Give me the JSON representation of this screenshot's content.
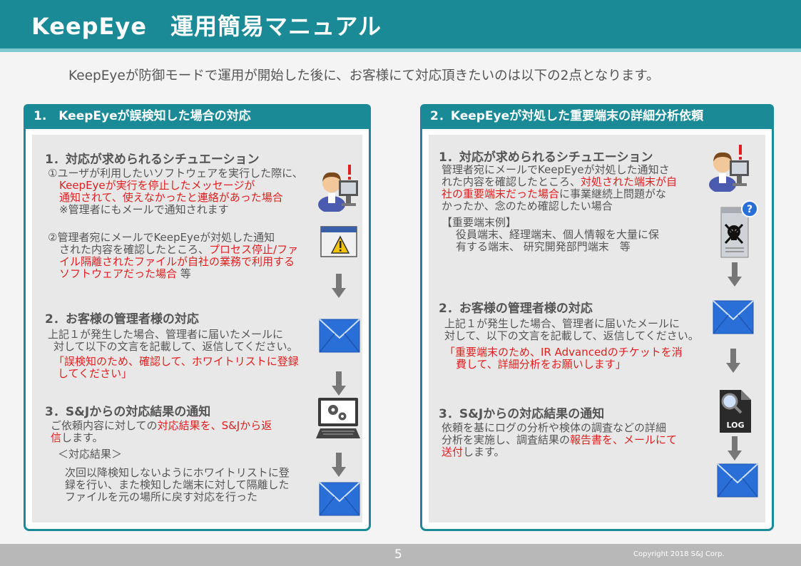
{
  "header": {
    "title": "KeepEye　運用簡易マニュアル"
  },
  "intro": "KeepEyeが防御モードで運用が開始した後に、お客様にて対応頂きたいのは以下の2点となります。",
  "left": {
    "heading": "1.　KeepEyeが誤検知した場合の対応",
    "s1": {
      "title": "1．対応が求められるシチュエーション",
      "c1": {
        "l1": "①ユーザが利用したいソフトウェアを実行した際に、",
        "l2": "KeepEyeが実行を停止したメッセージが",
        "l3": "通知されて、使えなかったと連絡があった場合",
        "l4": "※管理者にもメールで通知されます"
      },
      "c2": {
        "l1": "②管理者宛にメールでKeepEyeが対処した通知",
        "l2a": "された内容を確認したところ、",
        "l2b": "プロセス停止/ファ",
        "l3": "イル隔離されたファイルが自社の業務で利用する",
        "l4a": "ソフトウェアだった場合",
        "l4b": " 等"
      }
    },
    "s2": {
      "title": "2．お客様の管理者様の対応",
      "l1": "上記１が発生した場合、管理者に届いたメールに",
      "l2": "対して以下の文言を記載して、返信してください。",
      "l3": "「誤検知のため、確認して、ホワイトリストに登録",
      "l4": "してください」"
    },
    "s3": {
      "title": "3．S&Jからの対応結果の通知",
      "l1a": "ご依頼内容に対しての",
      "l1b": "対応結果を、S&Jから返",
      "l2a": "信",
      "l2b": "します。",
      "l3": "＜対応結果＞",
      "l4": "次回以降検知しないようにホワイトリストに登",
      "l5": "録を行い、また検知した端末に対して隔離した",
      "l6": "ファイルを元の場所に戻す対応を行った"
    }
  },
  "right": {
    "heading": "2．KeepEyeが対処した重要端末の詳細分析依頼",
    "s1": {
      "title": "1．対応が求められるシチュエーション",
      "l1": "管理者宛にメールでKeepEyeが対処した通知さ",
      "l2a": "れた内容を確認したところ、",
      "l2b": "対処された端末が自",
      "l3a": "社の重要端末だった場合",
      "l3b": "に事業継続上問題がな",
      "l4": "かったか、念のため確認したい場合",
      "l5": "【重要端末例】",
      "l6": "役員端末、経理端末、個人情報を大量に保",
      "l7": "有する端末、 研究開発部門端末　等"
    },
    "s2": {
      "title": "2．お客様の管理者様の対応",
      "l1": "上記１が発生した場合、管理者に届いたメールに",
      "l2": "対して、以下の文言を記載して、返信してください。",
      "l3": "「重要端末のため、IR Advancedのチケットを消",
      "l4": "費して、詳細分析をお願いします」"
    },
    "s3": {
      "title": "3．S&Jからの対応結果の通知",
      "l1": "依頼を基にログの分析や検体の調査などの詳細",
      "l2a": "分析を実施し、調査結果の",
      "l2b": "報告書を、メールにて",
      "l3a": "送付",
      "l3b": "します。"
    },
    "log_label": "LOG"
  },
  "footer": {
    "page": "5",
    "copyright": "Copyright 2018 S&J Corp."
  },
  "colors": {
    "teal": "#1a8a96",
    "red": "#e02020",
    "mail": "#2a6ed8"
  }
}
